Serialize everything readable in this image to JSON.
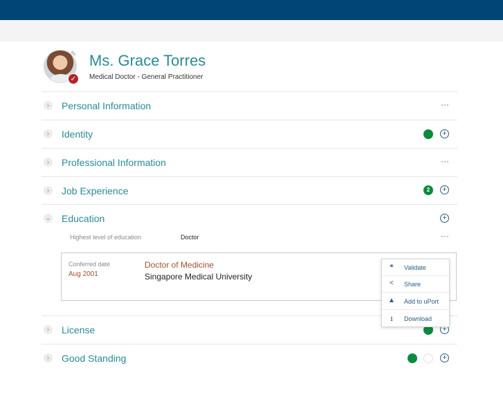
{
  "profile": {
    "name": "Ms. Grace Torres",
    "role": "Medical Doctor - General Practitioner"
  },
  "sections": [
    {
      "label": "Personal Information",
      "expanded": false
    },
    {
      "label": "Identity",
      "expanded": false,
      "status": "green-dot"
    },
    {
      "label": "Professional Information",
      "expanded": false
    },
    {
      "label": "Job Experience",
      "expanded": false,
      "count": "2"
    },
    {
      "label": "Education",
      "expanded": true
    },
    {
      "label": "License",
      "expanded": false,
      "status": "green-dot"
    },
    {
      "label": "Good Standing",
      "expanded": false,
      "status": "green-dot"
    }
  ],
  "education": {
    "highest_label": "Highest level of education",
    "highest_value": "Doctor",
    "entry": {
      "conferred_label": "Conferred date",
      "conferred_value": "Aug 2001",
      "degree": "Doctor of Medicine",
      "institution": "Singapore Medical University"
    }
  },
  "context_menu": {
    "items": [
      {
        "label": "Validate",
        "icon": "link-icon"
      },
      {
        "label": "Share",
        "icon": "share-icon"
      },
      {
        "label": "Add to uPort",
        "icon": "uport-icon"
      },
      {
        "label": "Download",
        "icon": "download-icon"
      }
    ]
  },
  "colors": {
    "header": "#014576",
    "accent": "#2a8a95",
    "status_green": "#0a8a3e",
    "badge_red": "#b0262a"
  }
}
